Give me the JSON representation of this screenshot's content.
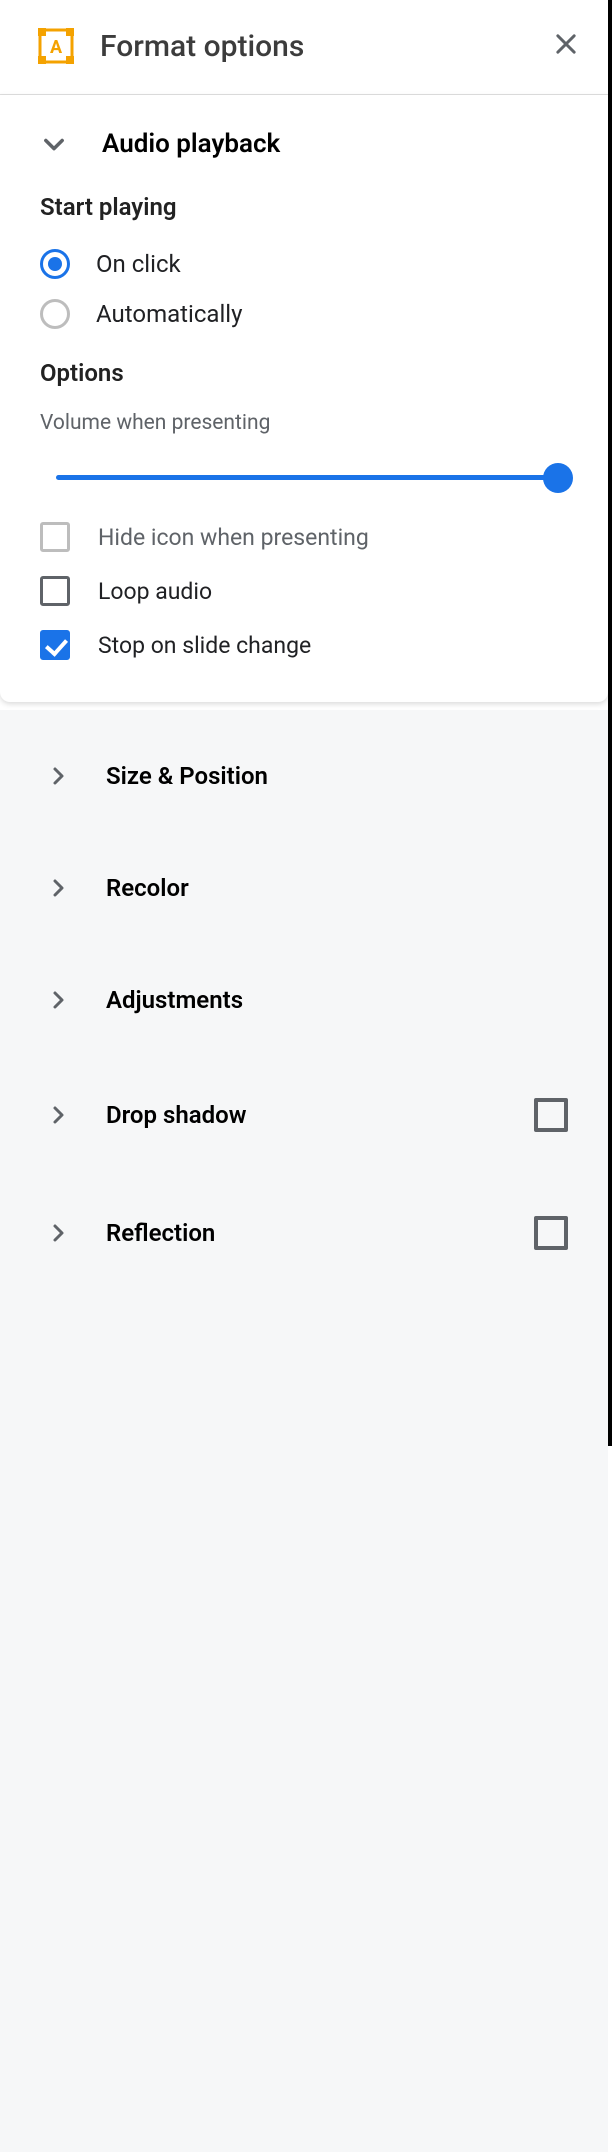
{
  "header": {
    "title": "Format options"
  },
  "audio_playback": {
    "title": "Audio playback",
    "start_playing_label": "Start playing",
    "radios": {
      "on_click": "On click",
      "automatically": "Automatically"
    },
    "options_label": "Options",
    "volume_label": "Volume when presenting",
    "volume_value": 100,
    "checks": {
      "hide_icon": "Hide icon when presenting",
      "loop_audio": "Loop audio",
      "stop_on_change": "Stop on slide change"
    }
  },
  "collapsed": {
    "size_position": "Size & Position",
    "recolor": "Recolor",
    "adjustments": "Adjustments",
    "drop_shadow": "Drop shadow",
    "reflection": "Reflection"
  }
}
